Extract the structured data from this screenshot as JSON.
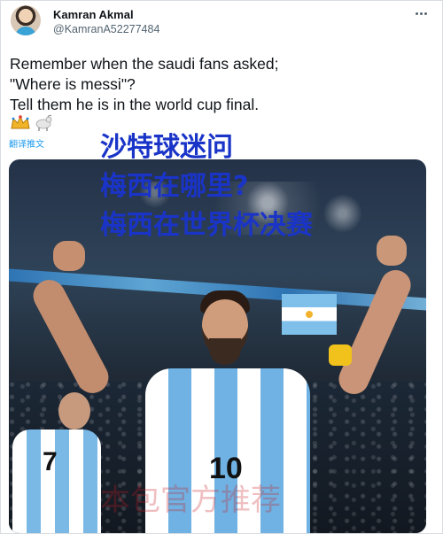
{
  "user": {
    "name": "Kamran Akmal",
    "handle": "@KamranA52277484"
  },
  "tweet": {
    "lines": [
      "Remember when the saudi fans asked;",
      "\"Where is messi\"?",
      "Tell them he is in the world cup final."
    ],
    "emoji_icons": [
      "crown-icon",
      "goat-icon"
    ],
    "translate_label": "翻译推文"
  },
  "overlay_text": {
    "lines": [
      "沙特球迷问",
      "梅西在哪里?",
      "梅西在世界杯决赛"
    ],
    "color": "#1a34c8"
  },
  "photo": {
    "jersey_number": "10",
    "background_jersey_number": "7"
  },
  "watermark": {
    "text": "本包官方推荐",
    "color": "#c81d24"
  },
  "colors": {
    "text": "#0f1419",
    "muted": "#536471",
    "link": "#1d9bf0"
  }
}
